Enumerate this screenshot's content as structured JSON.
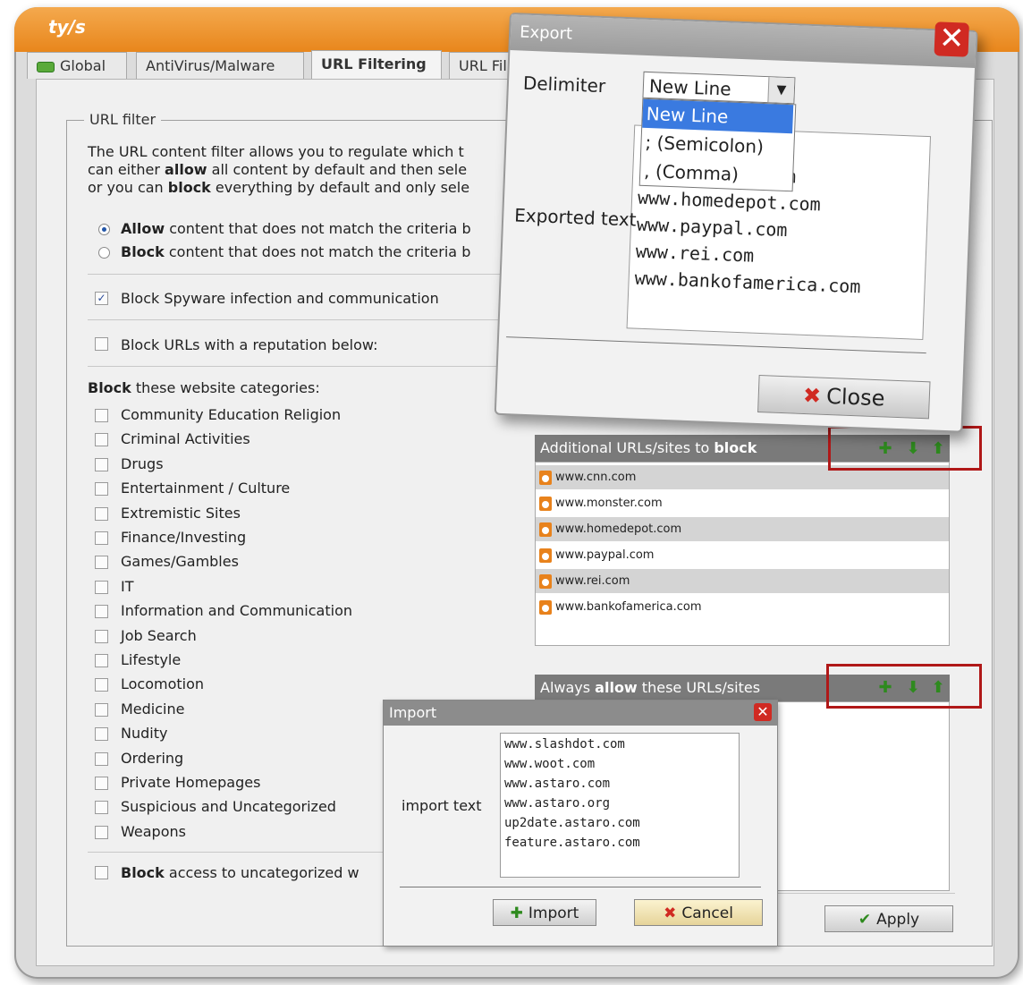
{
  "window": {
    "title": "ty/s"
  },
  "tabs": [
    {
      "label": "Global"
    },
    {
      "label": "AntiVirus/Malware"
    },
    {
      "label": "URL Filtering"
    },
    {
      "label": "URL Fil"
    }
  ],
  "url_filter": {
    "legend": "URL filter",
    "description": [
      [
        "The URL content filter allows you to regulate which t",
        "",
        ""
      ],
      [
        "can either ",
        "allow",
        " all content by default and then sele"
      ],
      [
        "or you can ",
        "block",
        " everything by default and only sele"
      ]
    ],
    "radio_allow": {
      "bold": "Allow",
      "rest": " content that does not match the criteria b"
    },
    "radio_block": {
      "bold": "Block",
      "rest": " content that does not match the criteria b"
    },
    "spyware_label": "Block Spyware infection and communication",
    "reputation_label": "Block URLs with a reputation below:",
    "categories_heading": {
      "bold": "Block",
      "rest": " these website categories:"
    },
    "categories": [
      "Community Education Religion",
      "Criminal Activities",
      "Drugs",
      "Entertainment / Culture",
      "Extremistic Sites",
      "Finance/Investing",
      "Games/Gambles",
      "IT",
      "Information and Communication",
      "Job Search",
      "Lifestyle",
      "Locomotion",
      "Medicine",
      "Nudity",
      "Ordering",
      "Private Homepages",
      "Suspicious and Uncategorized",
      "Weapons"
    ],
    "uncategorized": {
      "bold": "Block",
      "rest": " access to uncategorized w"
    }
  },
  "block_list": {
    "header_pre": "Additional URLs/sites to ",
    "header_bold": "block",
    "items": [
      "www.cnn.com",
      "www.monster.com",
      "www.homedepot.com",
      "www.paypal.com",
      "www.rei.com",
      "www.bankofamerica.com"
    ]
  },
  "allow_list": {
    "header_pre": "Always ",
    "header_bold": "allow",
    "header_post": " these URLs/sites"
  },
  "export_dialog": {
    "title": "Export",
    "delimiter_label": "Delimiter",
    "selected": "New Line",
    "options": [
      "New Line",
      "; (Semicolon)",
      ", (Comma)"
    ],
    "exported_label": "Exported text",
    "lines": [
      "m",
      "www.homedepot.com",
      "www.paypal.com",
      "www.rei.com",
      "www.bankofamerica.com"
    ],
    "close_label": "Close"
  },
  "import_dialog": {
    "title": "Import",
    "label": "import text",
    "lines": [
      "www.slashdot.com",
      "www.woot.com",
      "www.astaro.com",
      "www.astaro.org",
      "up2date.astaro.com",
      "feature.astaro.com"
    ],
    "import_label": "Import",
    "cancel_label": "Cancel"
  },
  "apply_label": "Apply",
  "colors": {
    "title_orange": "#e8861c",
    "accent_red": "#b01818",
    "icon_green": "#2e8a1e"
  }
}
